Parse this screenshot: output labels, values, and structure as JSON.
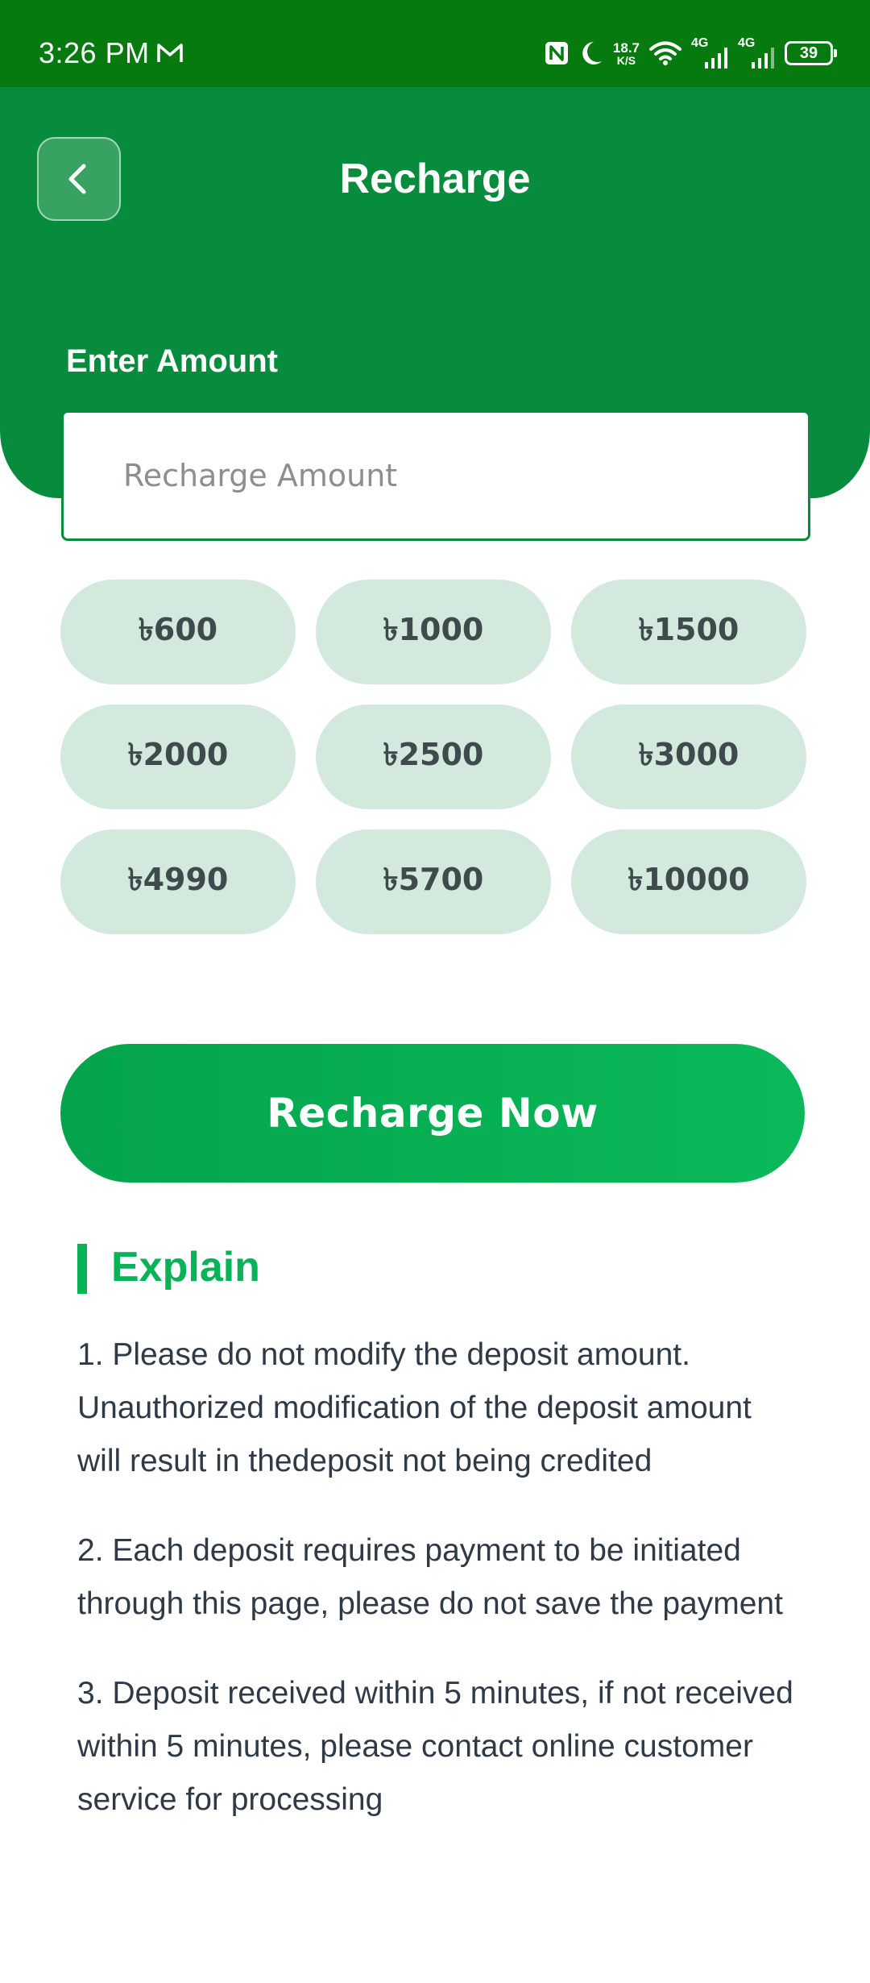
{
  "status_bar": {
    "time": "3:26 PM",
    "net_speed_value": "18.7",
    "net_speed_unit": "K/S",
    "cell_1_label": "4G",
    "cell_2_label": "4G",
    "battery_level": "39",
    "icons": [
      "mail-icon",
      "nfc-icon",
      "moon-icon",
      "wifi-icon",
      "signal-icon",
      "battery-icon"
    ]
  },
  "header": {
    "title": "Recharge",
    "back_icon": "chevron-left-icon"
  },
  "form": {
    "label": "Enter Amount",
    "placeholder": "Recharge Amount",
    "value": ""
  },
  "presets": [
    "৳600",
    "৳1000",
    "৳1500",
    "৳2000",
    "৳2500",
    "৳3000",
    "৳4990",
    "৳5700",
    "৳10000"
  ],
  "cta": {
    "label": "Recharge Now"
  },
  "explain": {
    "title": "Explain",
    "items": [
      "1. Please do not modify the deposit amount. Unauthorized modification of the deposit amount will result in thedeposit not being credited",
      "2. Each deposit requires payment to be initiated through this page, please do not save the payment",
      "3. Deposit received within 5 minutes, if not received within 5 minutes, please contact online customer service for processing"
    ]
  },
  "colors": {
    "status_bar": "#067a0e",
    "header": "#078b3c",
    "accent": "#08b256",
    "chip_bg": "#d4e9de"
  }
}
